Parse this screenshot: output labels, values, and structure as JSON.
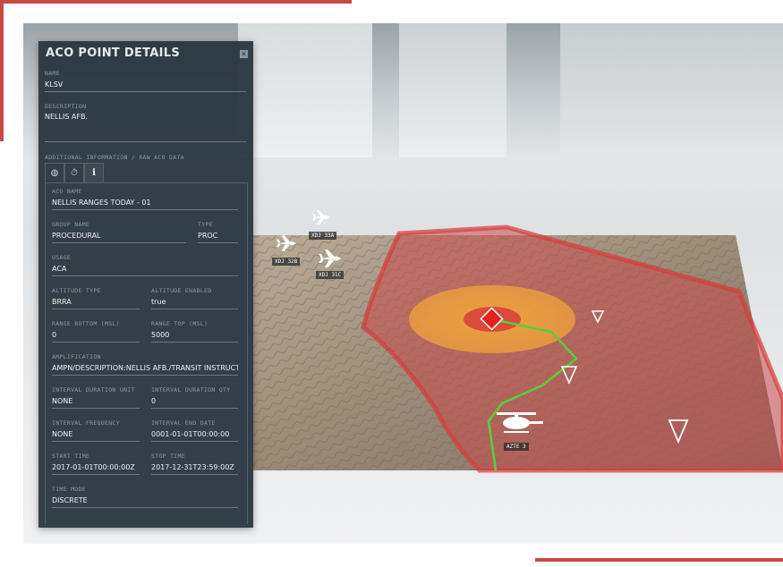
{
  "panel": {
    "title": "ACO POINT DETAILS",
    "close_icon": "close-icon",
    "name_label": "NAME",
    "name_value": "KLSV",
    "description_label": "DESCRIPTION",
    "description_value": "NELLIS AFB.",
    "additional_label": "ADDITIONAL INFORMATION / RAW ACO DATA",
    "tabs": [
      {
        "icon": "globe-icon",
        "glyph": "◍"
      },
      {
        "icon": "timer-icon",
        "glyph": "⏱"
      },
      {
        "icon": "info-icon",
        "glyph": "i",
        "active": true
      }
    ],
    "fields": {
      "aco_name": {
        "label": "ACO NAME",
        "value": "NELLIS RANGES TODAY - 01"
      },
      "group_name": {
        "label": "GROUP NAME",
        "value": "PROCEDURAL"
      },
      "type": {
        "label": "TYPE",
        "value": "PROC"
      },
      "usage": {
        "label": "USAGE",
        "value": "ACA"
      },
      "altitude_type": {
        "label": "ALTITUDE TYPE",
        "value": "BRRA"
      },
      "altitude_enabled": {
        "label": "ALTITUDE ENABLED",
        "value": "true"
      },
      "range_bottom": {
        "label": "RANGE BOTTOM (MSL)",
        "value": "0"
      },
      "range_top": {
        "label": "RANGE TOP (MSL)",
        "value": "5000"
      },
      "amplification": {
        "label": "AMPLIFICATION",
        "value": "AMPN/DESCRIPTION:NELLIS AFB./TRANSIT INSTRUCTIO"
      },
      "interval_duration_unit": {
        "label": "INTERVAL DURATION UNIT",
        "value": "NONE"
      },
      "interval_duration_qty": {
        "label": "INTERVAL DURATION QTY",
        "value": "0"
      },
      "interval_frequency": {
        "label": "INTERVAL FREQUENCY",
        "value": "NONE"
      },
      "interval_end_date": {
        "label": "INTERVAL END DATE",
        "value": "0001-01-01T00:00:00"
      },
      "start_time": {
        "label": "START TIME",
        "value": "2017-01-01T00:00:00Z"
      },
      "stop_time": {
        "label": "STOP TIME",
        "value": "2017-12-31T23:59:00Z"
      },
      "time_mode": {
        "label": "TIME MODE",
        "value": "DISCRETE"
      }
    }
  },
  "map": {
    "aircraft": [
      {
        "label": "XDJ 33A",
        "icon": "jet-icon"
      },
      {
        "label": "XDJ 32B",
        "icon": "jet-icon"
      },
      {
        "label": "XDJ 31C",
        "icon": "jet-icon"
      }
    ],
    "helicopter": {
      "label": "AZTE 3",
      "icon": "helicopter-icon"
    },
    "waypoint_icon": "diamond-waypoint-icon",
    "colors": {
      "zone_fill": "#c94a4a",
      "threat_ring": "#f2a030",
      "route": "#56d13a",
      "marker": "#e3211d",
      "frame_accent": "#c84a45"
    }
  }
}
